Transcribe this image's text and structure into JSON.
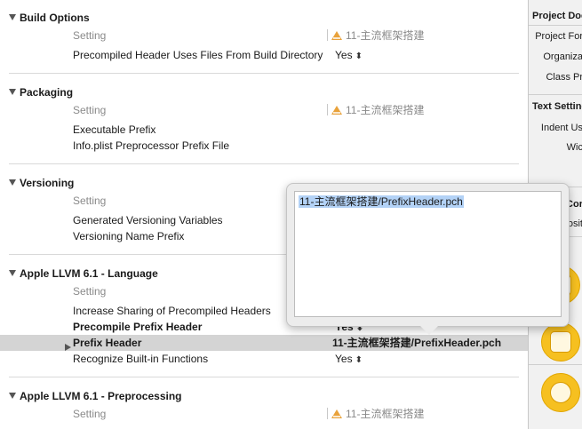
{
  "sections": {
    "build_options": {
      "title": "Build Options",
      "setting_col": "Setting",
      "target_name": "11-主流框架搭建",
      "rows": [
        {
          "label": "Precompiled Header Uses Files From Build Directory",
          "value": "Yes"
        }
      ]
    },
    "packaging": {
      "title": "Packaging",
      "setting_col": "Setting",
      "target_name": "11-主流框架搭建",
      "rows": [
        {
          "label": "Executable Prefix",
          "value": ""
        },
        {
          "label": "Info.plist Preprocessor Prefix File",
          "value": ""
        }
      ]
    },
    "versioning": {
      "title": "Versioning",
      "setting_col": "Setting",
      "rows": [
        {
          "label": "Generated Versioning Variables",
          "value": ""
        },
        {
          "label": "Versioning Name Prefix",
          "value": ""
        }
      ]
    },
    "llvm_language": {
      "title": "Apple LLVM 6.1 - Language",
      "setting_col": "Setting",
      "rows": [
        {
          "label": "Increase Sharing of Precompiled Headers",
          "value": ""
        },
        {
          "label": "Precompile Prefix Header",
          "value": "Yes"
        },
        {
          "label": "Prefix Header",
          "value": "11-主流框架搭建/PrefixHeader.pch"
        },
        {
          "label": "Recognize Built-in Functions",
          "value": "Yes"
        }
      ]
    },
    "llvm_preprocessing": {
      "title": "Apple LLVM 6.1 - Preprocessing",
      "setting_col": "Setting",
      "target_name": "11-主流框架搭建"
    }
  },
  "popover": {
    "text": "11-主流框架搭建/PrefixHeader.pch"
  },
  "inspector": {
    "project_doc": "Project Doc",
    "project_format": "Project For",
    "organization": "Organiza",
    "class_prefix": "Class Pr",
    "text_settings": "Text Setting",
    "indent_using": "Indent Us",
    "widths": "Wic",
    "cor": "Cor",
    "osi": "osit"
  },
  "colors": {
    "selected_row": "#d4d4d4",
    "selection_highlight": "#b3d2f6",
    "library_icon": "#f6c020"
  }
}
